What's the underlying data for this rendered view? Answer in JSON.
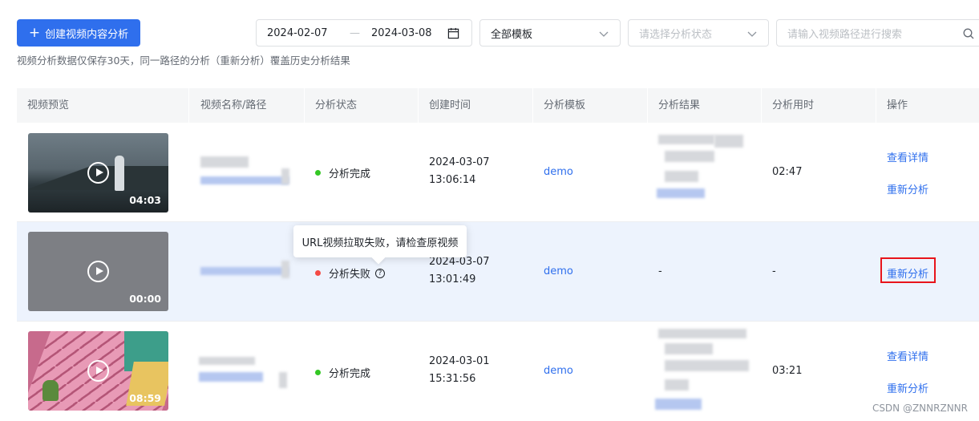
{
  "toolbar": {
    "create_label": "创建视频内容分析",
    "date_start": "2024-02-07",
    "date_sep": "—",
    "date_end": "2024-03-08",
    "template_value": "全部模板",
    "status_placeholder": "请选择分析状态",
    "search_placeholder": "请输入视频路径进行搜索"
  },
  "notice": "视频分析数据仅保存30天，同一路径的分析（重新分析）覆盖历史分析结果",
  "table": {
    "headers": [
      "视频预览",
      "视频名称/路径",
      "分析状态",
      "创建时间",
      "分析模板",
      "分析结果",
      "分析用时",
      "操作"
    ],
    "rows": [
      {
        "duration": "04:03",
        "status": "分析完成",
        "status_color": "#34c724",
        "created_date": "2024-03-07",
        "created_time": "13:06:14",
        "template": "demo",
        "result": "",
        "elapsed": "02:47",
        "action_detail": "查看详情",
        "action_reanalyze": "重新分析"
      },
      {
        "duration": "00:00",
        "status": "分析失败",
        "status_color": "#f54a45",
        "created_date": "2024-03-07",
        "created_time": "13:01:49",
        "template": "demo",
        "result": "-",
        "elapsed": "-",
        "action_reanalyze": "重新分析"
      },
      {
        "duration": "08:59",
        "status": "分析完成",
        "status_color": "#34c724",
        "created_date": "2024-03-01",
        "created_time": "15:31:56",
        "template": "demo",
        "result": "",
        "elapsed": "03:21",
        "action_detail": "查看详情",
        "action_reanalyze": "重新分析"
      }
    ]
  },
  "tooltip": "URL视频拉取失败，请检查原视频",
  "watermark": "CSDN @ZNNRZNNR",
  "colors": {
    "accent": "#2f6fed",
    "highlight_row": "#edf3fd",
    "annotation_red": "#e8141b"
  }
}
